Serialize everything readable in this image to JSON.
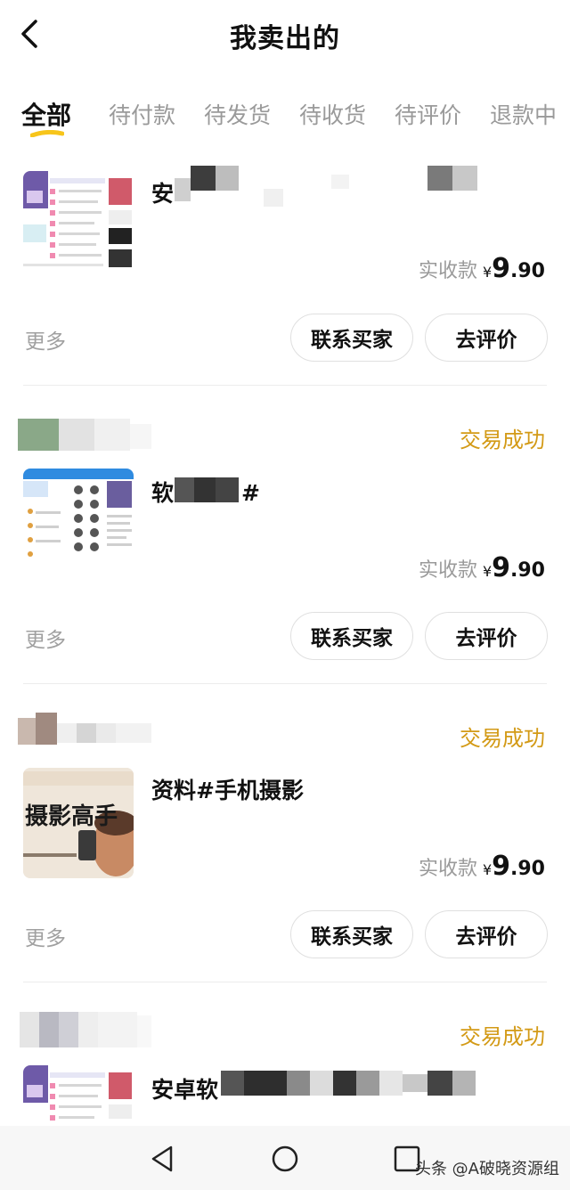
{
  "header": {
    "title": "我卖出的"
  },
  "tabs": [
    "全部",
    "待付款",
    "待发货",
    "待收货",
    "待评价",
    "退款中"
  ],
  "orders": [
    {
      "title_visible": "安",
      "status": "",
      "received_label": "实收款",
      "currency": "¥",
      "amount_int": "9",
      "amount_dec": ".90",
      "more": "更多",
      "contact_button": "联系买家",
      "review_button": "去评价"
    },
    {
      "title_visible_start": "软",
      "title_visible_end": "#",
      "status": "交易成功",
      "received_label": "实收款",
      "currency": "¥",
      "amount_int": "9",
      "amount_dec": ".90",
      "more": "更多",
      "contact_button": "联系买家",
      "review_button": "去评价"
    },
    {
      "title_visible": "资料#手机摄影",
      "thumb_text": "摄影高手",
      "status": "交易成功",
      "received_label": "实收款",
      "currency": "¥",
      "amount_int": "9",
      "amount_dec": ".90",
      "more": "更多",
      "contact_button": "联系买家",
      "review_button": "去评价"
    },
    {
      "title_visible": "安卓软",
      "status": "交易成功"
    }
  ],
  "watermark": "头条 @A破晓资源组",
  "colors": {
    "accent": "#f7c51b",
    "status": "#d39a16",
    "muted": "#9a9a9a"
  },
  "icons": [
    "back-arrow-icon",
    "nav-back-icon",
    "nav-home-icon",
    "nav-recents-icon"
  ]
}
